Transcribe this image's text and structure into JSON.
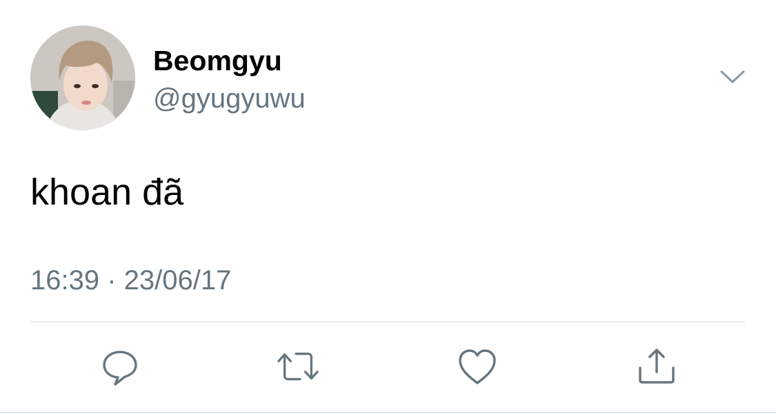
{
  "tweet": {
    "author": {
      "display_name": "Beomgyu",
      "handle": "@gyugyuwu",
      "avatar_icon": "profile-photo"
    },
    "text": "khoan đã",
    "timestamp": "16:39 · 23/06/17",
    "menu_icon": "chevron-down-icon",
    "actions": [
      {
        "name": "reply",
        "icon": "speech-bubble-icon"
      },
      {
        "name": "retweet",
        "icon": "retweet-arrows-icon"
      },
      {
        "name": "like",
        "icon": "heart-icon"
      },
      {
        "name": "share",
        "icon": "share-upload-icon"
      }
    ]
  },
  "colors": {
    "text_primary": "#000000",
    "text_secondary": "#66757f",
    "icon": "#66757f",
    "divider": "#d8dfe4"
  }
}
